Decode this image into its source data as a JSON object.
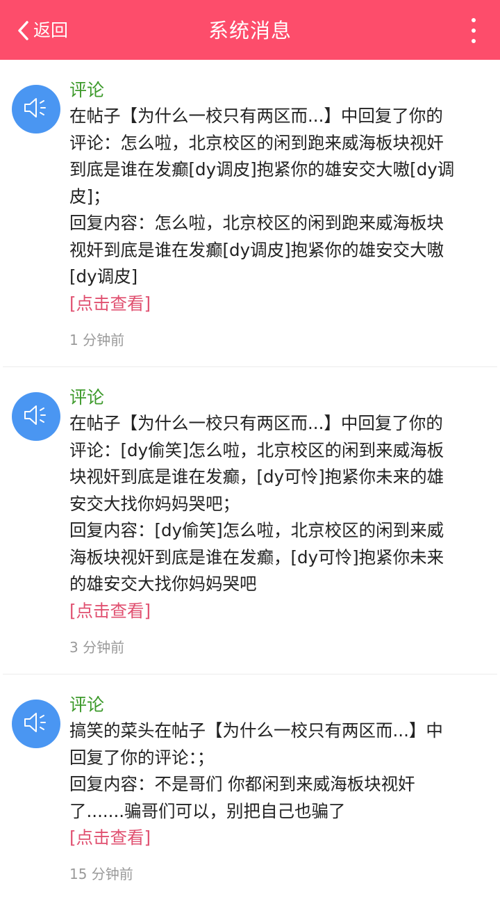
{
  "header": {
    "back_label": "返回",
    "title": "系统消息"
  },
  "colors": {
    "header_bg": "#fd4d6b",
    "avatar_bg": "#4a96f2",
    "type_text": "#3d9a2b",
    "link_text": "#e05070"
  },
  "messages": [
    {
      "type": "评论",
      "icon": "speaker-icon",
      "lines": [
        "在帖子【为什么一校只有两区而...】中回复了你的",
        "评论：怎么啦，北京校区的闲到跑来威海板块视奸",
        "到底是谁在发癫[dy调皮]抱紧你的雄安交大嗷[dy调",
        "皮]；",
        "回复内容：怎么啦，北京校区的闲到跑来威海板块",
        "视奸到底是谁在发癫[dy调皮]抱紧你的雄安交大嗷",
        "[dy调皮]"
      ],
      "view_label": "[点击查看]",
      "time": "1 分钟前"
    },
    {
      "type": "评论",
      "icon": "speaker-icon",
      "lines": [
        "在帖子【为什么一校只有两区而...】中回复了你的",
        "评论：[dy偷笑]怎么啦，北京校区的闲到来威海板",
        "块视奸到底是谁在发癫，[dy可怜]抱紧你未来的雄",
        "安交大找你妈妈哭吧；",
        "回复内容：[dy偷笑]怎么啦，北京校区的闲到来威",
        "海板块视奸到底是谁在发癫，[dy可怜]抱紧你未来",
        "的雄安交大找你妈妈哭吧"
      ],
      "view_label": "[点击查看]",
      "time": "3 分钟前"
    },
    {
      "type": "评论",
      "icon": "speaker-icon",
      "lines": [
        "搞笑的菜头在帖子【为什么一校只有两区而...】中",
        "回复了你的评论：；",
        "回复内容：不是哥们 你都闲到来威海板块视奸",
        "了.......骗哥们可以，别把自己也骗了"
      ],
      "view_label": "[点击查看]",
      "time": "15 分钟前"
    }
  ]
}
